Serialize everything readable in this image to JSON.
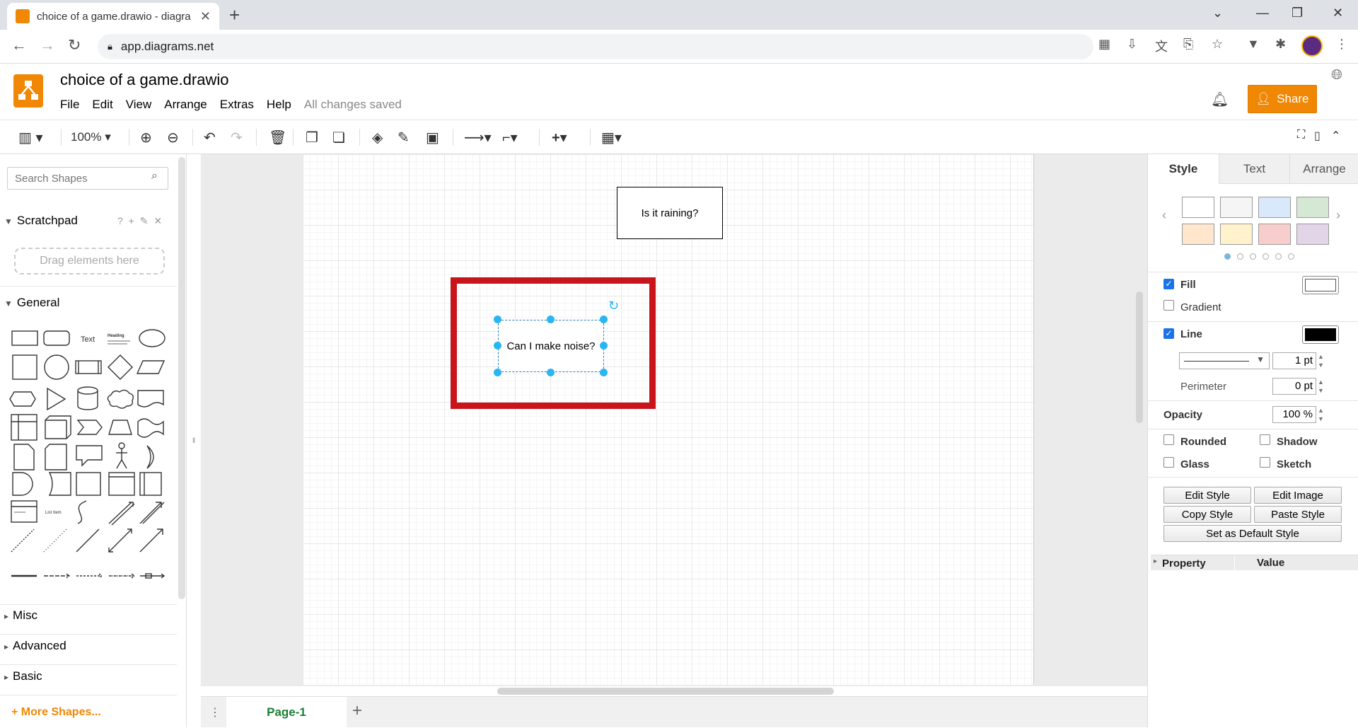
{
  "browser": {
    "tab_title": "choice of a game.drawio - diagra",
    "url": "app.diagrams.net"
  },
  "app": {
    "doc_title": "choice of a game.drawio",
    "menu": [
      "File",
      "Edit",
      "View",
      "Arrange",
      "Extras",
      "Help"
    ],
    "save_status": "All changes saved",
    "share_label": "Share"
  },
  "toolbar": {
    "zoom": "100%"
  },
  "left_panel": {
    "search_placeholder": "Search Shapes",
    "scratchpad_label": "Scratchpad",
    "scratchpad_icons": "? + ✎ ✕",
    "drag_hint": "Drag elements here",
    "general_label": "General",
    "shape_text_label": "Text",
    "shape_heading_label": "Heading",
    "shape_list_item_label": "List Item",
    "sections": [
      "Misc",
      "Advanced",
      "Basic"
    ],
    "more_shapes": "+ More Shapes..."
  },
  "canvas": {
    "node1_text": "Is it raining?",
    "node2_text": "Can I make noise?",
    "page_tab": "Page-1"
  },
  "right_panel": {
    "tabs": [
      "Style",
      "Text",
      "Arrange"
    ],
    "swatches": [
      "#ffffff",
      "#f5f5f5",
      "#dae8fc",
      "#d5e8d4",
      "#ffe6cc",
      "#fff2cc",
      "#f8cecc",
      "#e1d5e7"
    ],
    "fill_label": "Fill",
    "gradient_label": "Gradient",
    "line_label": "Line",
    "line_width": "1 pt",
    "perimeter_label": "Perimeter",
    "perimeter_value": "0 pt",
    "opacity_label": "Opacity",
    "opacity_value": "100 %",
    "rounded_label": "Rounded",
    "shadow_label": "Shadow",
    "glass_label": "Glass",
    "sketch_label": "Sketch",
    "btn_edit_style": "Edit Style",
    "btn_edit_image": "Edit Image",
    "btn_copy_style": "Copy Style",
    "btn_paste_style": "Paste Style",
    "btn_default_style": "Set as Default Style",
    "prop_header": "Property",
    "value_header": "Value"
  }
}
